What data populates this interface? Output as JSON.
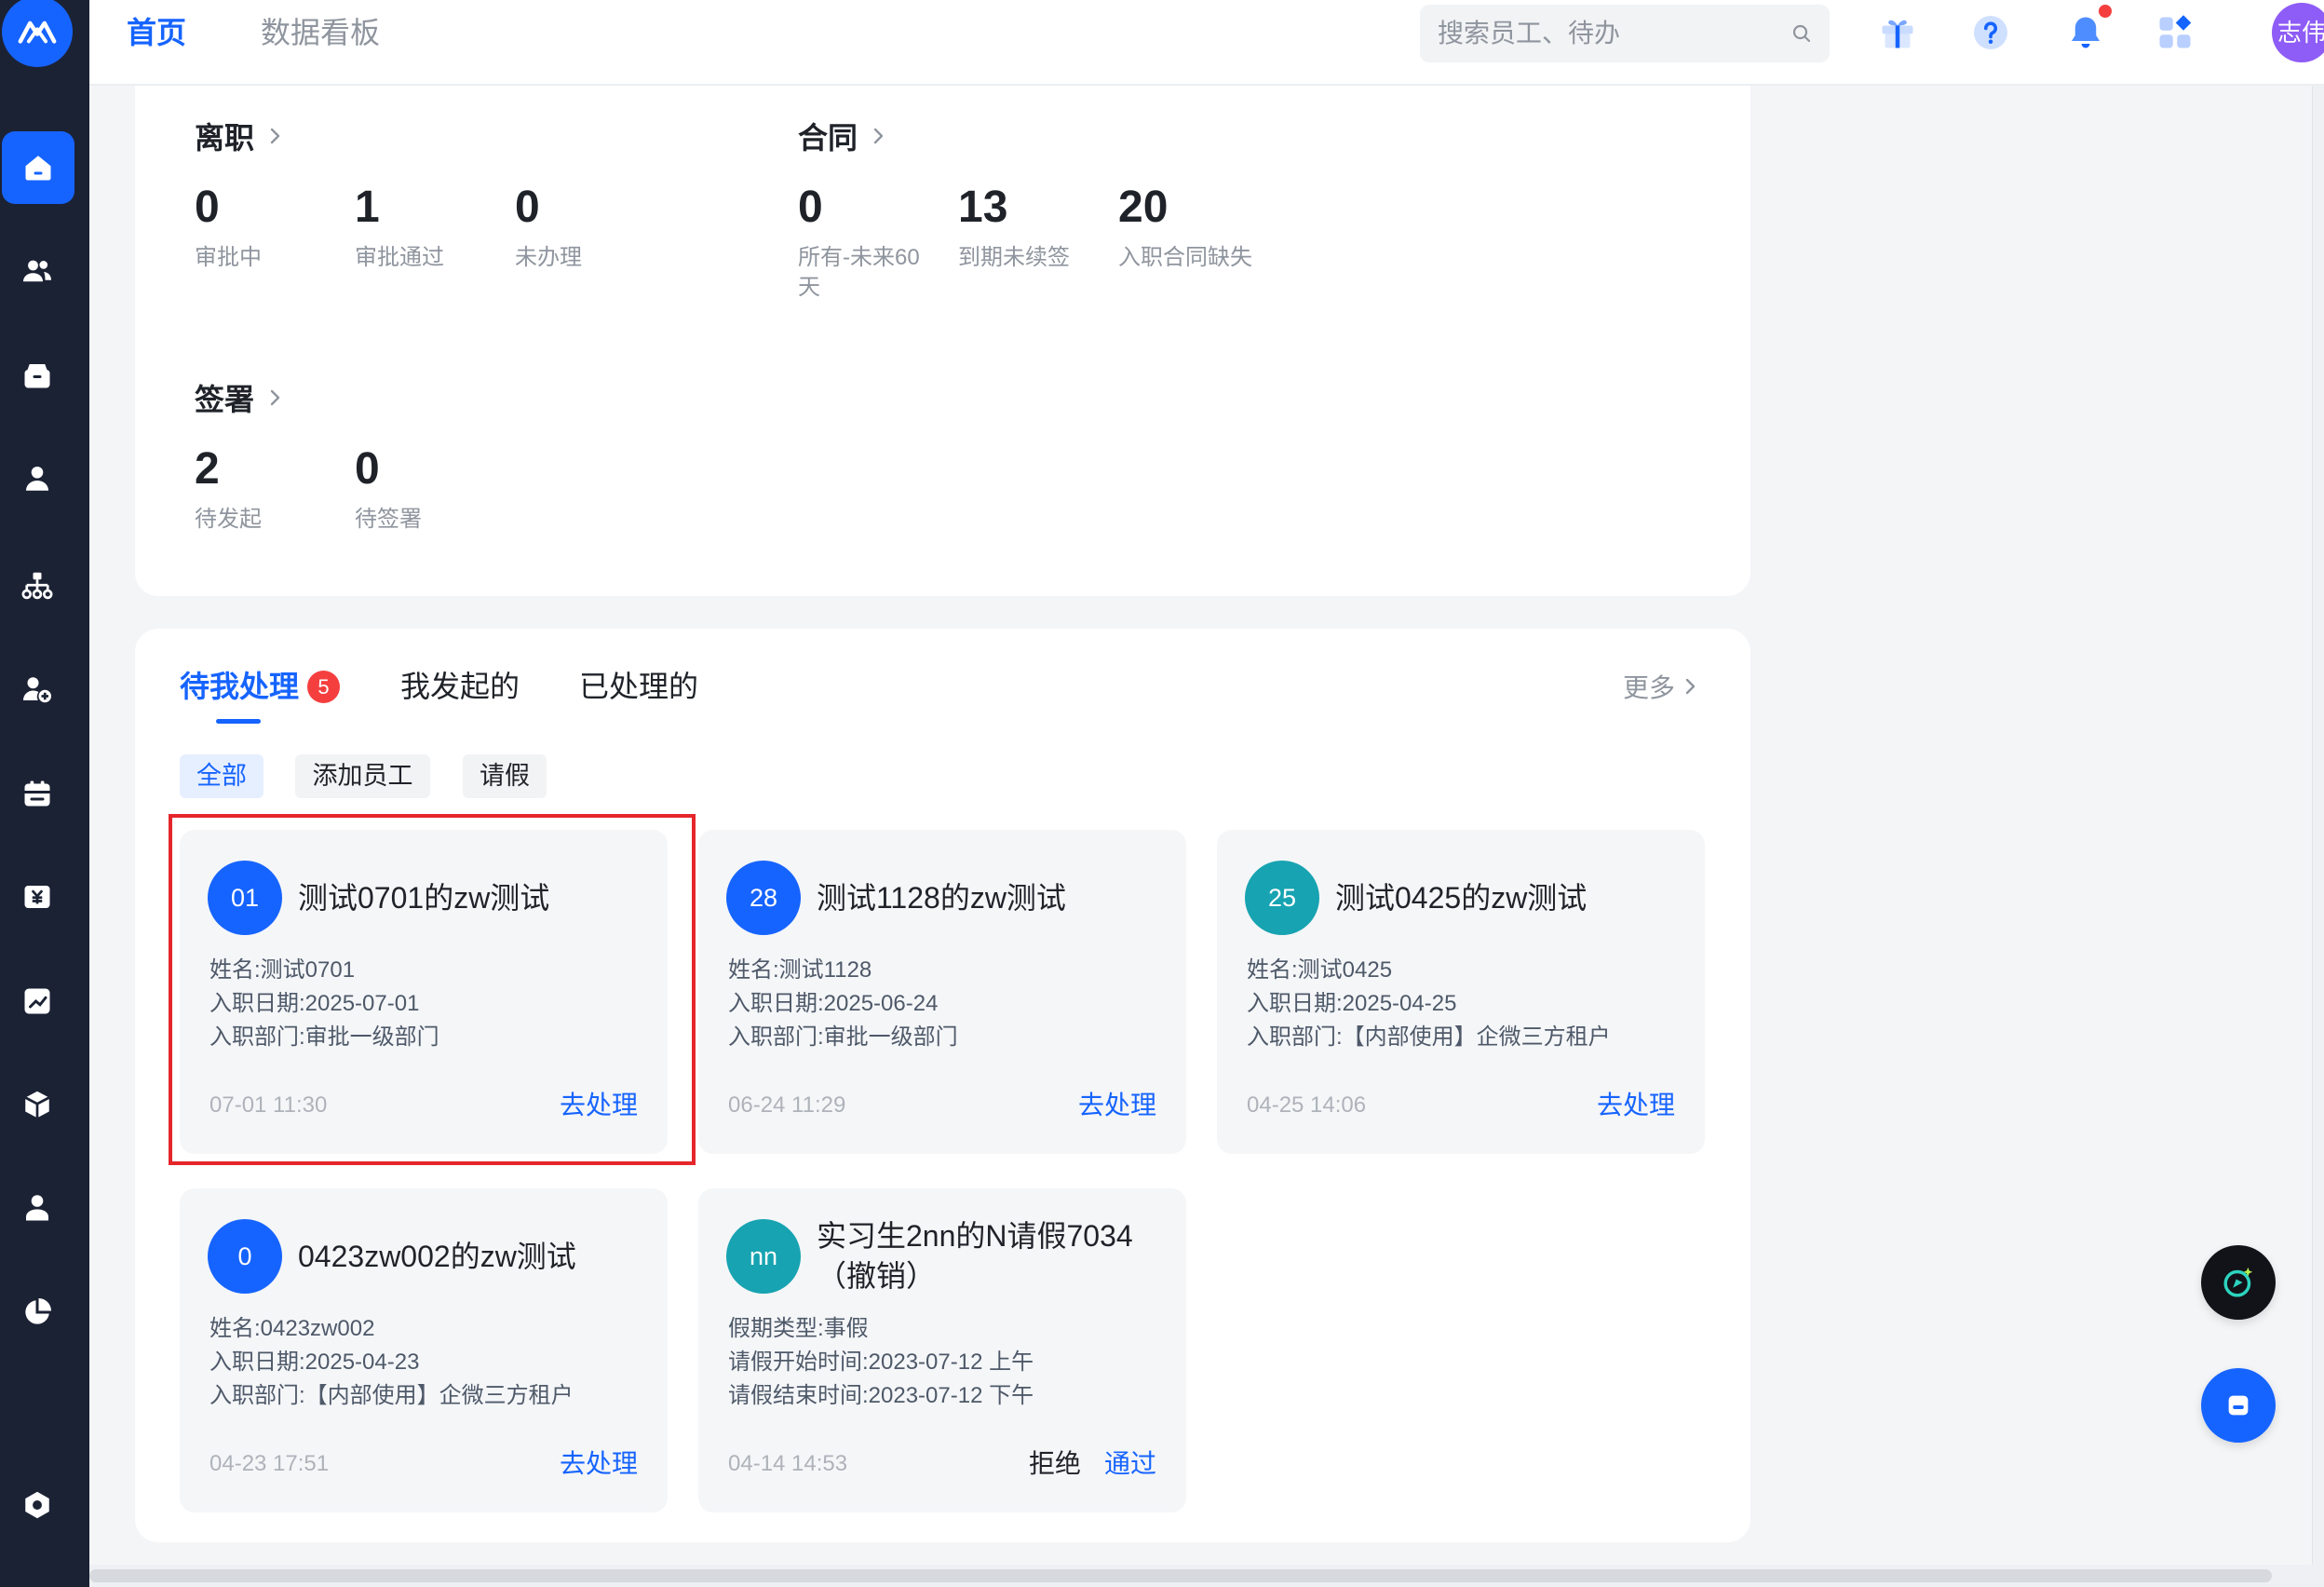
{
  "app": {
    "logo_icon": "logo-icon"
  },
  "sidebar": {
    "items": [
      {
        "icon": "home-icon",
        "active": true
      },
      {
        "icon": "team-icon"
      },
      {
        "icon": "archive-icon"
      },
      {
        "icon": "employee-icon"
      },
      {
        "icon": "org-chart-icon"
      },
      {
        "icon": "add-user-icon"
      },
      {
        "icon": "calendar-icon"
      },
      {
        "icon": "salary-icon"
      },
      {
        "icon": "report-icon"
      },
      {
        "icon": "cube-icon"
      },
      {
        "icon": "profile-icon"
      },
      {
        "icon": "pie-chart-icon"
      },
      {
        "icon": "settings-icon"
      }
    ]
  },
  "header": {
    "tabs": [
      {
        "label": "首页",
        "active": true
      },
      {
        "label": "数据看板",
        "active": false
      }
    ],
    "search_placeholder": "搜索员工、待办",
    "icons": [
      "search-icon",
      "gift-icon",
      "help-icon",
      "bell-icon",
      "apps-icon"
    ],
    "avatar_text": "志伟"
  },
  "stats": {
    "resignation": {
      "title": "离职",
      "items": [
        {
          "value": "0",
          "label": "审批中"
        },
        {
          "value": "1",
          "label": "审批通过"
        },
        {
          "value": "0",
          "label": "未办理"
        }
      ]
    },
    "contract": {
      "title": "合同",
      "items": [
        {
          "value": "0",
          "label": "所有-未来60天"
        },
        {
          "value": "13",
          "label": "到期未续签"
        },
        {
          "value": "20",
          "label": "入职合同缺失"
        }
      ]
    },
    "signing": {
      "title": "签署",
      "items": [
        {
          "value": "2",
          "label": "待发起"
        },
        {
          "value": "0",
          "label": "待签署"
        }
      ]
    }
  },
  "tasks": {
    "tabs": [
      {
        "label": "待我处理",
        "badge": "5",
        "active": true
      },
      {
        "label": "我发起的",
        "active": false
      },
      {
        "label": "已处理的",
        "active": false
      }
    ],
    "more_label": "更多",
    "filters": [
      {
        "label": "全部",
        "active": true
      },
      {
        "label": "添加员工",
        "active": false
      },
      {
        "label": "请假",
        "active": false
      }
    ],
    "cards": [
      {
        "avatar": "01",
        "avatar_color": "#1664ff",
        "title": "测试0701的zw测试",
        "lines": [
          "姓名:测试0701",
          "入职日期:2025-07-01",
          "入职部门:审批一级部门"
        ],
        "time": "07-01 11:30",
        "actions": [
          "去处理"
        ],
        "highlighted": true
      },
      {
        "avatar": "28",
        "avatar_color": "#1664ff",
        "title": "测试1128的zw测试",
        "lines": [
          "姓名:测试1128",
          "入职日期:2025-06-24",
          "入职部门:审批一级部门"
        ],
        "time": "06-24 11:29",
        "actions": [
          "去处理"
        ]
      },
      {
        "avatar": "25",
        "avatar_color": "#17a3b1",
        "title": "测试0425的zw测试",
        "lines": [
          "姓名:测试0425",
          "入职日期:2025-04-25",
          "入职部门:【内部使用】企微三方租户"
        ],
        "time": "04-25 14:06",
        "actions": [
          "去处理"
        ]
      },
      {
        "avatar": "0",
        "avatar_color": "#1664ff",
        "title": "0423zw002的zw测试",
        "lines": [
          "姓名:0423zw002",
          "入职日期:2025-04-23",
          "入职部门:【内部使用】企微三方租户"
        ],
        "time": "04-23 17:51",
        "actions": [
          "去处理"
        ]
      },
      {
        "avatar": "nn",
        "avatar_color": "#17a3b1",
        "title": "实习生2nn的N请假7034（撤销）",
        "lines": [
          "假期类型:事假",
          "请假开始时间:2023-07-12 上午",
          "请假结束时间:2023-07-12 下午"
        ],
        "time": "04-14 14:53",
        "actions": [
          "拒绝",
          "通过"
        ]
      }
    ]
  },
  "floating": {
    "icons": [
      "ai-assistant-icon",
      "chat-icon"
    ]
  },
  "colors": {
    "accent": "#1664ff",
    "teal": "#17a3b1",
    "danger": "#f53f3f",
    "highlight": "#e5262b",
    "sidebar_bg": "#1b2234",
    "avatar_bg": "#8e5cf6"
  }
}
